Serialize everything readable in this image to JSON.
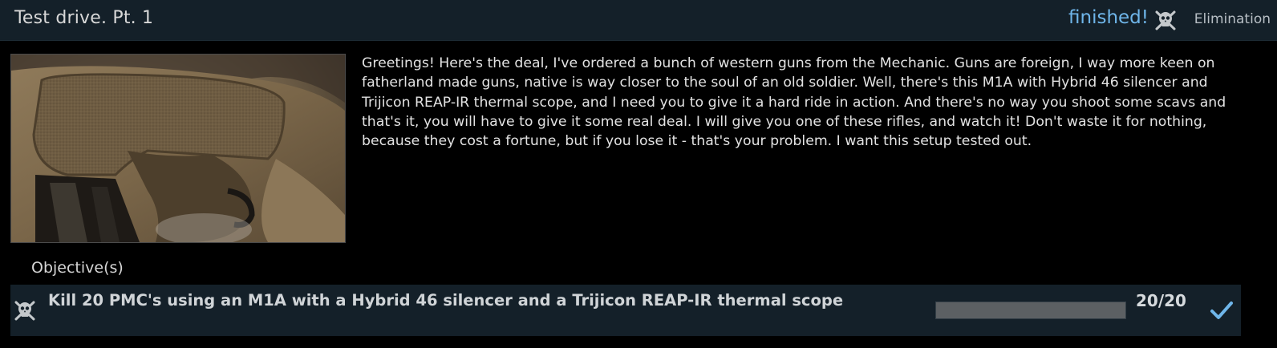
{
  "quest": {
    "title": "Test drive. Pt. 1",
    "status": "finished!",
    "status_color": "#6fb6ea",
    "type_icon": "skull-crossbones-icon",
    "type_label": "Elimination",
    "image": "rifle-stock-trigger-photo",
    "description": "Greetings! Here's the deal, I've ordered a bunch of western guns from the Mechanic. Guns are foreign, I way more keen on fatherland made guns, native is way closer to the soul of an old soldier. Well, there's this M1A with Hybrid 46 silencer and Trijicon REAP-IR thermal scope, and I need you to give it a hard ride in action. And there's no way you shoot some scavs and that's it, you will have to give it some real deal. I will give you one of these rifles, and watch it! Don't waste it for nothing, because they cost a fortune, but if you lose it - that's your problem. I want this setup tested out."
  },
  "objectives": {
    "heading": "Objective(s)",
    "items": [
      {
        "icon": "skull-crossbones-icon",
        "text": "Kill 20 PMC's using an M1A with a Hybrid 46 silencer and a Trijicon REAP-IR thermal scope",
        "progress_fraction": 1.0,
        "count": "20/20",
        "completed_icon": "checkmark-icon",
        "check_color": "#6fb6ea"
      }
    ]
  }
}
